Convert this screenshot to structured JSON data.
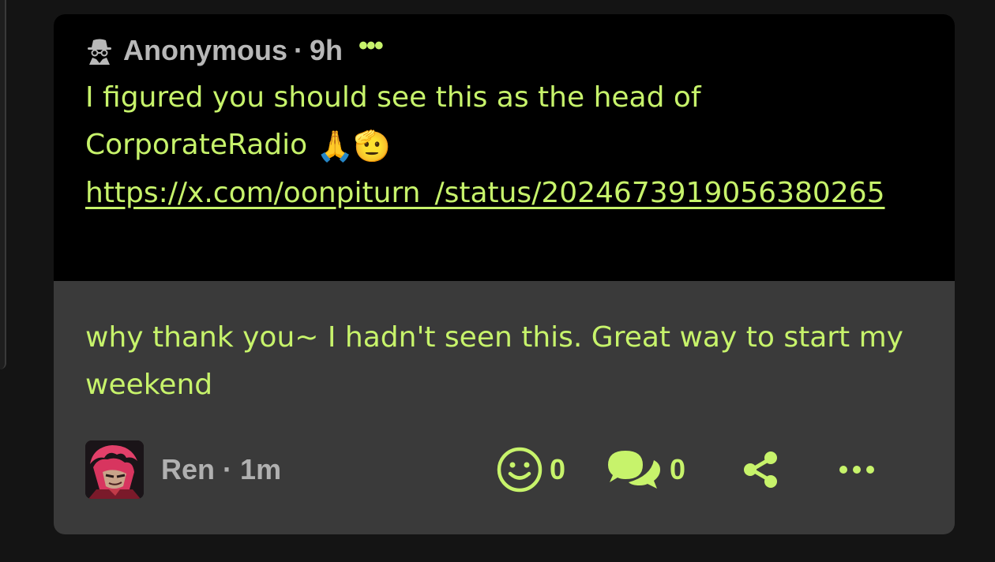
{
  "quoted_post": {
    "author": "Anonymous",
    "separator": "·",
    "time": "9h",
    "more_label": "•••",
    "text_line1": "I figured you should see this as the head of",
    "text_line2": "CorporateRadio",
    "emoji_pray": "🙏",
    "emoji_salute": "🫡",
    "link": "https://x.com/oonpiturn_/status/2024673919056380265"
  },
  "reply": {
    "text": "why thank you~ I hadn't seen this. Great way to start my weekend",
    "author": "Ren",
    "separator": "·",
    "time": "1m",
    "reaction_count": "0",
    "comment_count": "0",
    "more_label": "•••"
  },
  "icons": {
    "anonymous": "spy-icon",
    "reaction": "smiley-icon",
    "comments": "speech-bubbles-icon",
    "share": "share-icon",
    "more": "ellipsis-icon"
  },
  "colors": {
    "accent": "#c7f36b",
    "muted_text": "#b0b0b0",
    "card_bg": "#3a3a3a",
    "quote_bg": "#000000",
    "page_bg": "#141414"
  }
}
